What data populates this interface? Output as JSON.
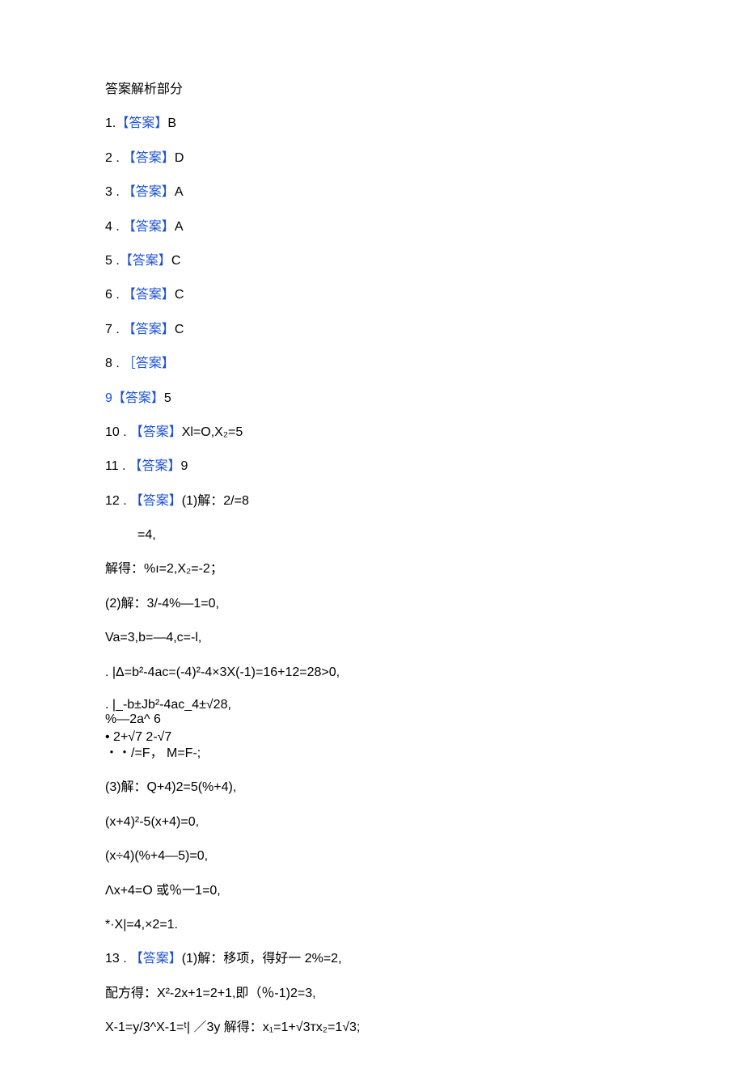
{
  "header": "答案解析部分",
  "items": [
    {
      "num": "1.",
      "label": "【答案】",
      "val": "B"
    },
    {
      "num": "2  .",
      "label": "【答案】",
      "val": "D"
    },
    {
      "num": "3  .",
      "label": "【答案】",
      "val": "A"
    },
    {
      "num": "4  .",
      "label": "【答案】",
      "val": "A"
    },
    {
      "num": "5  .",
      "label": "【答案】",
      "val": "C"
    },
    {
      "num": "6  .",
      "label": "【答案】",
      "val": "C"
    },
    {
      "num": "7  .",
      "label": "【答案】",
      "val": "C"
    },
    {
      "num": "8  .",
      "label": "［答案】",
      "val": ""
    },
    {
      "num": "9",
      "label": "【答案】",
      "val": "5"
    },
    {
      "num": "10  .",
      "label": "【答案】",
      "val": "Xl=O,X₂=5"
    },
    {
      "num": "11  .",
      "label": "【答案】",
      "val": "9"
    }
  ],
  "item12": {
    "num": "12  .",
    "label": "【答案】",
    "lead": "(1)解：2/=8",
    "lines": [
      "=4,",
      "解得：%ı=2,X₂=-2；",
      "(2)解：3/-4%—1=0,",
      "Va=3,b=—4,c=-l,",
      ". |Δ=b²-4ac=(-4)²-4×3X(-1)=16+12=28>0,",
      ". |_-b±Jb²-4ac_4±√28,",
      "   %—2a^                         6",
      "•         2+√7            2-√7",
      " ・・/=F， M=F-;",
      "(3)解：Q+4)2=5(%+4),",
      "(x+4)²-5(x+4)=0,",
      "(x÷4)(%+4—5)=0,",
      "Λx+4=O 或％一1=0,",
      "*·X|=4,×2=1."
    ]
  },
  "item13": {
    "num": "13  .",
    "label": "【答案】",
    "lead": "(1)解：移项，得好一 2%=2,",
    "lines": [
      "配方得：X²-2x+1=2+1,即（％-1)2=3,",
      "X-1=y/3^X-1=ᵗ| ／3y 解得：x₁=1+√3тx₂=1√3;"
    ]
  }
}
